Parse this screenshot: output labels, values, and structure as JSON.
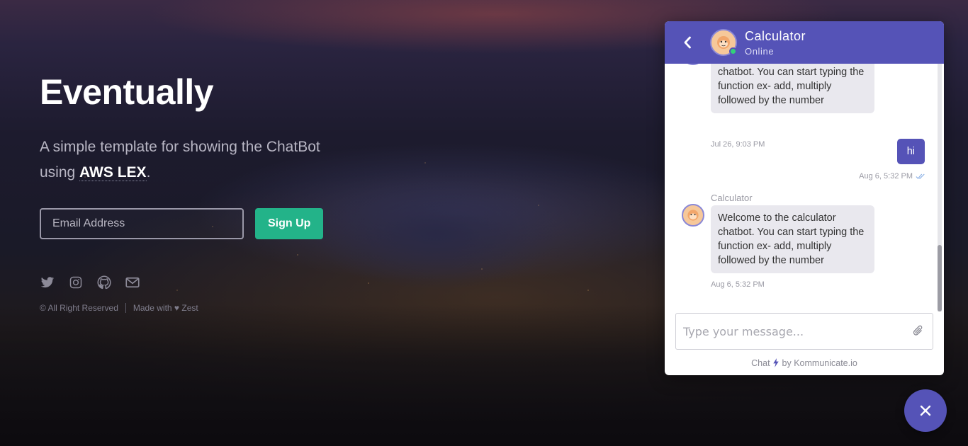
{
  "hero": {
    "title": "Eventually",
    "subtitle_part1": "A simple template for showing the ChatBot using ",
    "subtitle_bold": "AWS LEX",
    "subtitle_end": ".",
    "email_placeholder": "Email Address",
    "signup_label": "Sign Up"
  },
  "social": [
    "twitter-icon",
    "instagram-icon",
    "github-icon",
    "mail-icon"
  ],
  "footer": {
    "rights": "© All Right Reserved",
    "made_with": "Made with ♥ Zest"
  },
  "chat": {
    "bot_name": "Calculator",
    "status": "Online",
    "messages": [
      {
        "type": "in",
        "text_partial": "chatbot. You can start typing the function ex- add, multiply followed by the number",
        "time": "Jul 26, 9:03 PM"
      },
      {
        "type": "out",
        "text": "hi",
        "time": "Aug 6, 5:32 PM"
      },
      {
        "type": "in",
        "sender": "Calculator",
        "text": "Welcome to the calculator chatbot. You can start typing the function ex- add, multiply followed by the number",
        "time": "Aug 6, 5:32 PM"
      }
    ],
    "composer_placeholder": "Type your message...",
    "powered_prefix": "Chat",
    "powered_suffix": "by Kommunicate.io"
  },
  "colors": {
    "brand": "#5553b7",
    "signup_green": "#23b389",
    "online": "#32d17a"
  }
}
